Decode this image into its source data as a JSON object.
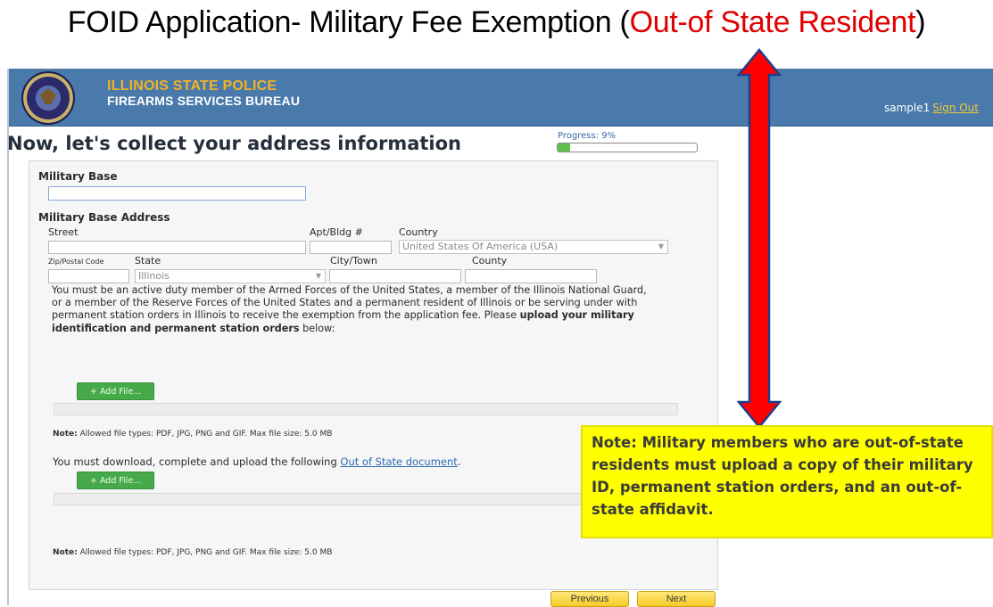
{
  "slide": {
    "title_prefix": "FOID Application- Military Fee Exemption (",
    "title_highlight": "Out-of State Resident",
    "title_suffix": ")"
  },
  "header": {
    "agency_line1": "ILLINOIS STATE POLICE",
    "agency_line2": "FIREARMS SERVICES BUREAU",
    "username": "sample1",
    "signout_label": "Sign Out"
  },
  "page": {
    "heading": "Now, let's collect your address information",
    "progress_label": "Progress: 9%",
    "progress_value": 0.09
  },
  "form": {
    "military_base_label": "Military Base",
    "military_base_value": "",
    "address_section_label": "Military Base Address",
    "street_label": "Street",
    "apt_label": "Apt/Bldg #",
    "country_label": "Country",
    "country_value": "United States Of America (USA)",
    "zip_label": "Zip/Postal Code",
    "state_label": "State",
    "state_value": "Illinois",
    "city_label": "City/Town",
    "county_label": "County",
    "para_text": "You must be an active duty member of the Armed Forces of the United States, a member of the Illinois National Guard, or a member of the Reserve Forces of the United States and a permanent resident of Illinois or be serving under with permanent station orders in Illinois to receive the exemption from the application fee. Please ",
    "para_bold": "upload your military identification and permanent station orders",
    "para_tail": " below:",
    "add_file_label": "+ Add File...",
    "note_bold": "Note:",
    "note_text": " Allowed file types: PDF, JPG, PNG and GIF. Max file size: 5.0 MB",
    "download_text": "You must download, complete and upload the following ",
    "download_link": "Out of State document",
    "download_tail": "."
  },
  "nav": {
    "previous_label": "Previous",
    "next_label": "Next"
  },
  "callout": {
    "text": "Note: Military members who are out-of-state residents must upload a copy of their military ID, permanent station orders, and an out-of-state affidavit."
  },
  "colors": {
    "banner": "#4a7aab",
    "accent_green": "#46a94a",
    "nav_button": "#f6cc2a",
    "callout_bg": "#ffff00",
    "arrow": "#ff0000"
  }
}
